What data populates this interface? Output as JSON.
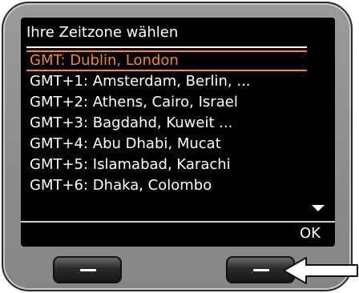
{
  "screen": {
    "title": "Ihre Zeitzone wählen",
    "timezones": [
      "GMT: Dublin, London",
      "GMT+1: Amsterdam, Berlin, ...",
      "GMT+2: Athens, Cairo, Israel",
      "GMT+3: Bagdahd, Kuweit ...",
      "GMT+4: Abu Dhabi, Mucat",
      "GMT+5: Islamabad, Karachi",
      "GMT+6: Dhaka, Colombo"
    ],
    "selected_index": 0,
    "right_softkey_label": "OK"
  },
  "colors": {
    "selection": "#f08a28",
    "screen_bg": "#000000",
    "device_body": "#8c8c8c"
  },
  "icons": {
    "scroll": "triangle-down-icon",
    "pointer": "left-arrow-icon"
  }
}
